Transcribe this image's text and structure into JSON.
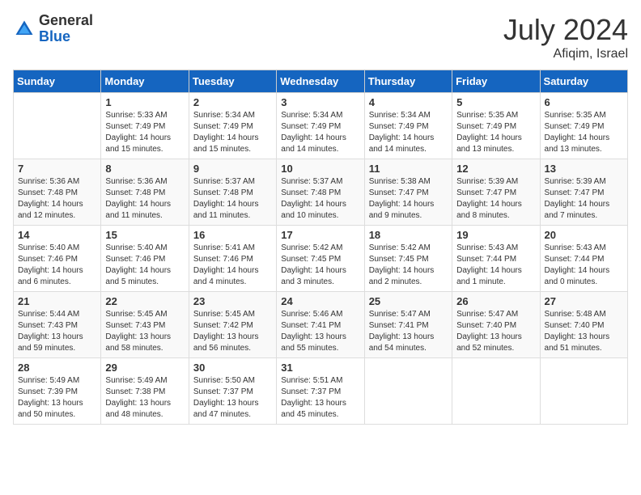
{
  "header": {
    "logo_general": "General",
    "logo_blue": "Blue",
    "month_year": "July 2024",
    "location": "Afiqim, Israel"
  },
  "weekdays": [
    "Sunday",
    "Monday",
    "Tuesday",
    "Wednesday",
    "Thursday",
    "Friday",
    "Saturday"
  ],
  "weeks": [
    [
      {
        "day": "",
        "info": ""
      },
      {
        "day": "1",
        "info": "Sunrise: 5:33 AM\nSunset: 7:49 PM\nDaylight: 14 hours\nand 15 minutes."
      },
      {
        "day": "2",
        "info": "Sunrise: 5:34 AM\nSunset: 7:49 PM\nDaylight: 14 hours\nand 15 minutes."
      },
      {
        "day": "3",
        "info": "Sunrise: 5:34 AM\nSunset: 7:49 PM\nDaylight: 14 hours\nand 14 minutes."
      },
      {
        "day": "4",
        "info": "Sunrise: 5:34 AM\nSunset: 7:49 PM\nDaylight: 14 hours\nand 14 minutes."
      },
      {
        "day": "5",
        "info": "Sunrise: 5:35 AM\nSunset: 7:49 PM\nDaylight: 14 hours\nand 13 minutes."
      },
      {
        "day": "6",
        "info": "Sunrise: 5:35 AM\nSunset: 7:49 PM\nDaylight: 14 hours\nand 13 minutes."
      }
    ],
    [
      {
        "day": "7",
        "info": "Sunrise: 5:36 AM\nSunset: 7:48 PM\nDaylight: 14 hours\nand 12 minutes."
      },
      {
        "day": "8",
        "info": "Sunrise: 5:36 AM\nSunset: 7:48 PM\nDaylight: 14 hours\nand 11 minutes."
      },
      {
        "day": "9",
        "info": "Sunrise: 5:37 AM\nSunset: 7:48 PM\nDaylight: 14 hours\nand 11 minutes."
      },
      {
        "day": "10",
        "info": "Sunrise: 5:37 AM\nSunset: 7:48 PM\nDaylight: 14 hours\nand 10 minutes."
      },
      {
        "day": "11",
        "info": "Sunrise: 5:38 AM\nSunset: 7:47 PM\nDaylight: 14 hours\nand 9 minutes."
      },
      {
        "day": "12",
        "info": "Sunrise: 5:39 AM\nSunset: 7:47 PM\nDaylight: 14 hours\nand 8 minutes."
      },
      {
        "day": "13",
        "info": "Sunrise: 5:39 AM\nSunset: 7:47 PM\nDaylight: 14 hours\nand 7 minutes."
      }
    ],
    [
      {
        "day": "14",
        "info": "Sunrise: 5:40 AM\nSunset: 7:46 PM\nDaylight: 14 hours\nand 6 minutes."
      },
      {
        "day": "15",
        "info": "Sunrise: 5:40 AM\nSunset: 7:46 PM\nDaylight: 14 hours\nand 5 minutes."
      },
      {
        "day": "16",
        "info": "Sunrise: 5:41 AM\nSunset: 7:46 PM\nDaylight: 14 hours\nand 4 minutes."
      },
      {
        "day": "17",
        "info": "Sunrise: 5:42 AM\nSunset: 7:45 PM\nDaylight: 14 hours\nand 3 minutes."
      },
      {
        "day": "18",
        "info": "Sunrise: 5:42 AM\nSunset: 7:45 PM\nDaylight: 14 hours\nand 2 minutes."
      },
      {
        "day": "19",
        "info": "Sunrise: 5:43 AM\nSunset: 7:44 PM\nDaylight: 14 hours\nand 1 minute."
      },
      {
        "day": "20",
        "info": "Sunrise: 5:43 AM\nSunset: 7:44 PM\nDaylight: 14 hours\nand 0 minutes."
      }
    ],
    [
      {
        "day": "21",
        "info": "Sunrise: 5:44 AM\nSunset: 7:43 PM\nDaylight: 13 hours\nand 59 minutes."
      },
      {
        "day": "22",
        "info": "Sunrise: 5:45 AM\nSunset: 7:43 PM\nDaylight: 13 hours\nand 58 minutes."
      },
      {
        "day": "23",
        "info": "Sunrise: 5:45 AM\nSunset: 7:42 PM\nDaylight: 13 hours\nand 56 minutes."
      },
      {
        "day": "24",
        "info": "Sunrise: 5:46 AM\nSunset: 7:41 PM\nDaylight: 13 hours\nand 55 minutes."
      },
      {
        "day": "25",
        "info": "Sunrise: 5:47 AM\nSunset: 7:41 PM\nDaylight: 13 hours\nand 54 minutes."
      },
      {
        "day": "26",
        "info": "Sunrise: 5:47 AM\nSunset: 7:40 PM\nDaylight: 13 hours\nand 52 minutes."
      },
      {
        "day": "27",
        "info": "Sunrise: 5:48 AM\nSunset: 7:40 PM\nDaylight: 13 hours\nand 51 minutes."
      }
    ],
    [
      {
        "day": "28",
        "info": "Sunrise: 5:49 AM\nSunset: 7:39 PM\nDaylight: 13 hours\nand 50 minutes."
      },
      {
        "day": "29",
        "info": "Sunrise: 5:49 AM\nSunset: 7:38 PM\nDaylight: 13 hours\nand 48 minutes."
      },
      {
        "day": "30",
        "info": "Sunrise: 5:50 AM\nSunset: 7:37 PM\nDaylight: 13 hours\nand 47 minutes."
      },
      {
        "day": "31",
        "info": "Sunrise: 5:51 AM\nSunset: 7:37 PM\nDaylight: 13 hours\nand 45 minutes."
      },
      {
        "day": "",
        "info": ""
      },
      {
        "day": "",
        "info": ""
      },
      {
        "day": "",
        "info": ""
      }
    ]
  ]
}
